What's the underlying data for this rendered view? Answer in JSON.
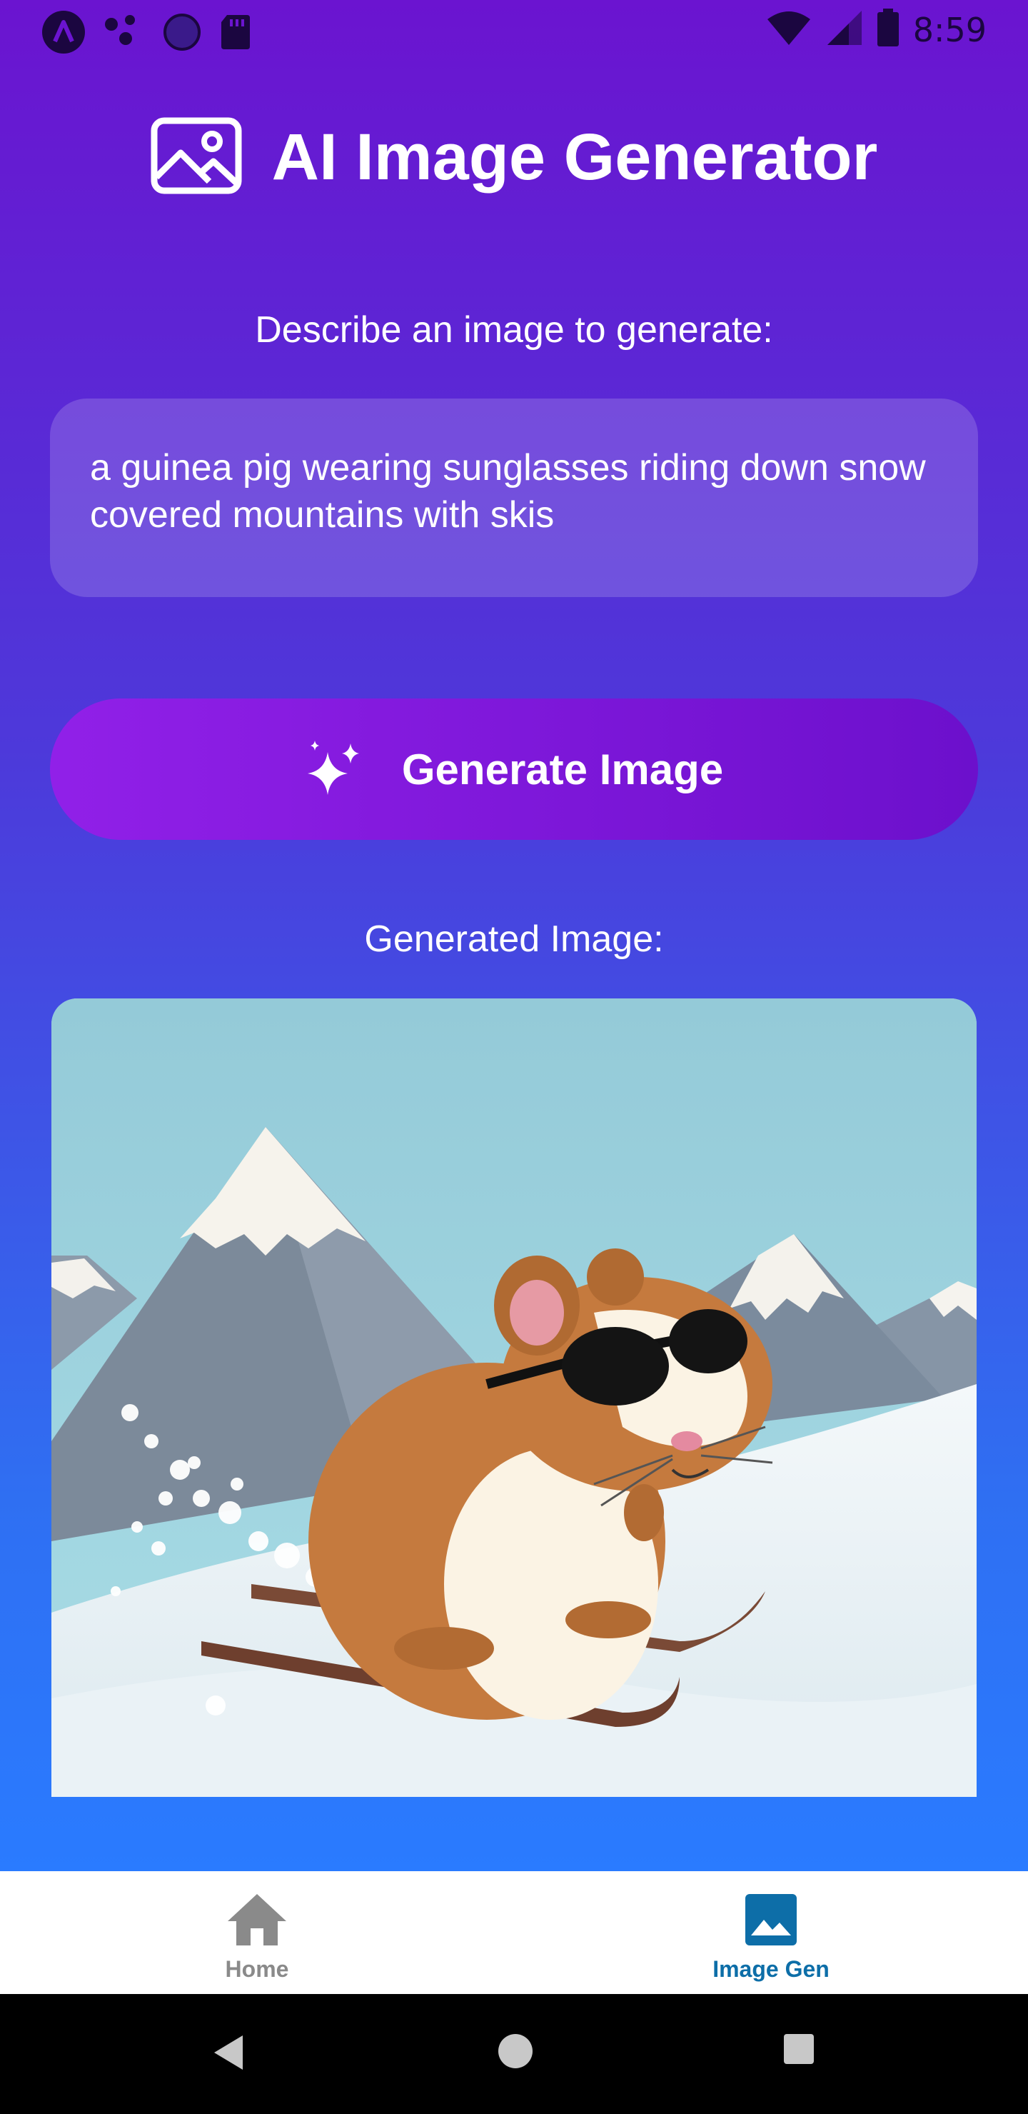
{
  "status_bar": {
    "time": "8:59",
    "left_icons": [
      "app-logo-icon",
      "dots-icon",
      "circle-icon",
      "sd-card-icon"
    ],
    "right_icons": [
      "wifi-icon",
      "signal-icon",
      "battery-icon"
    ]
  },
  "header": {
    "title": "AI Image Generator",
    "icon": "image-icon"
  },
  "prompt": {
    "label": "Describe an image to generate:",
    "value": "a guinea pig wearing sunglasses riding down snow covered mountains with skis"
  },
  "generate_button": {
    "label": "Generate Image",
    "icon": "sparkles-icon"
  },
  "result": {
    "label": "Generated Image:",
    "image_subject": "cartoon guinea pig in sunglasses skiing down snowy mountains"
  },
  "bottom_nav": {
    "items": [
      {
        "label": "Home",
        "icon": "home-icon",
        "active": false
      },
      {
        "label": "Image Gen",
        "icon": "image-gen-icon",
        "active": true
      }
    ],
    "active_color": "#0d6ea8",
    "inactive_color": "#8a8a8a"
  },
  "system_nav": {
    "buttons": [
      "back-icon",
      "home-circle-icon",
      "recents-icon"
    ]
  },
  "colors": {
    "gradient_top": "#6b14d0",
    "gradient_bottom": "#2a7bff",
    "button_start": "#9120e8",
    "button_end": "#6c10cc"
  }
}
